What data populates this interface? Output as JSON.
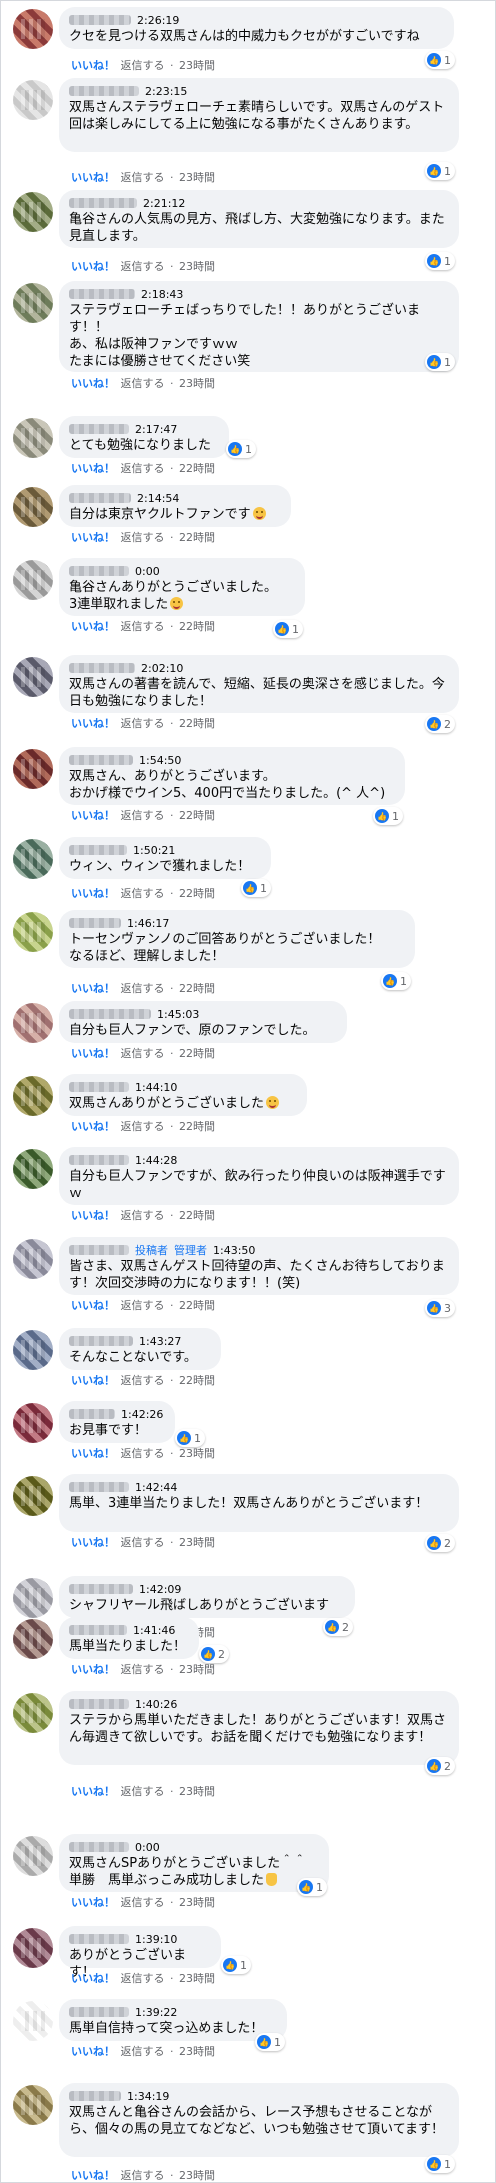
{
  "ui": {
    "like": "いいね！",
    "reply": "返信する",
    "sep": "·",
    "age_22": "22時間",
    "age_23": "23時間",
    "like_color": "#1877f2"
  },
  "comments": [
    {
      "time": "2:26:19",
      "text": "クセを見つける双馬さんは的中威力もクセががすごいですね",
      "react": "1",
      "age": "23時間"
    },
    {
      "time": "2:23:15",
      "text": "双馬さんステラヴェローチェ素晴らしいです。双馬さんのゲスト回は楽しみにしてる上に勉強になる事がたくさんあります。",
      "react": "1",
      "age": "23時間"
    },
    {
      "time": "2:21:12",
      "text": "亀谷さんの人気馬の見方、飛ばし方、大変勉強になります。また見直します。",
      "react": "1",
      "age": "23時間"
    },
    {
      "time": "2:18:43",
      "text": "ステラヴェローチェばっちりでした！！ありがとうございます！！\nあ、私は阪神ファンですｗｗ\nたまには優勝させてください笑",
      "react": "1",
      "age": "23時間"
    },
    {
      "time": "2:17:47",
      "text": "とても勉強になりました",
      "react": "1",
      "age": "22時間"
    },
    {
      "time": "2:14:54",
      "text": "自分は東京ヤクルトファンです",
      "react": "",
      "age": "22時間"
    },
    {
      "time": "0:00",
      "text": "亀谷さんありがとうございました。\n3連単取れました",
      "react": "1",
      "age": "22時間"
    },
    {
      "time": "2:02:10",
      "text": "双馬さんの著書を読んで、短縮、延長の奥深さを感じました。今日も勉強になりました！",
      "react": "2",
      "age": "22時間"
    },
    {
      "time": "1:54:50",
      "text": "双馬さん、ありがとうございます。\nおかげ様でウイン5、400円で当たりました。(^ 人^)",
      "react": "1",
      "age": "22時間"
    },
    {
      "time": "1:50:21",
      "text": "ウィン、ウィンで獲れました！",
      "react": "1",
      "age": "22時間"
    },
    {
      "time": "1:46:17",
      "text": "トーセンヴァンノのご回答ありがとうございました！\nなるほど、理解しました！",
      "react": "1",
      "age": "22時間"
    },
    {
      "time": "1:45:03",
      "text": "自分も巨人ファンで、原のファンでした。",
      "react": "",
      "age": "22時間"
    },
    {
      "time": "1:44:10",
      "text": "双馬さんありがとうございました",
      "react": "",
      "age": "22時間"
    },
    {
      "time": "1:44:28",
      "text": "自分も巨人ファンですが、飲み行ったり仲良いのは阪神選手ですｗ",
      "react": "",
      "age": "22時間"
    },
    {
      "time": "1:43:50",
      "badge1": "投稿者",
      "badge2": "管理者",
      "text": "皆さま、双馬さんゲスト回待望の声、たくさんお待ちしております！次回交渉時の力になります！！(笑)",
      "react": "3",
      "age": "22時間"
    },
    {
      "time": "1:43:27",
      "text": "そんなことないです。",
      "react": "",
      "age": "22時間"
    },
    {
      "time": "1:42:26",
      "text": "お見事です！",
      "react": "1",
      "age": "23時間"
    },
    {
      "time": "1:42:44",
      "text": "馬単、3連単当たりました！双馬さんありがとうございます！",
      "react": "2",
      "age": "23時間"
    },
    {
      "time": "1:42:09",
      "text": "シャフリヤール飛ばしありがとうございます",
      "react": "2",
      "age": "23時間"
    },
    {
      "time": "1:41:46",
      "text": "馬単当たりました！",
      "react": "2",
      "age": "23時間"
    },
    {
      "time": "1:40:26",
      "text": "ステラから馬単いただきました！ありがとうございます！双馬さん毎週きて欲しいです。お話を聞くだけでも勉強になります！",
      "react": "2",
      "age": "23時間"
    },
    {
      "time": "0:00",
      "text": "双馬さんSPありがとうございました＾＾\n単勝　馬単ぶっこみ成功しました",
      "react": "1",
      "age": "23時間"
    },
    {
      "time": "1:39:10",
      "text": "ありがとうございます！",
      "react": "1",
      "age": "23時間"
    },
    {
      "time": "1:39:22",
      "text": "馬単自信持って突っ込めました！",
      "react": "1",
      "age": "23時間"
    },
    {
      "time": "1:34:19",
      "text": "双馬さんと亀谷さんの会話から、レース予想もさせることながら、個々の馬の見立てなどなど、いつも勉強させて頂いてます！",
      "react": "1",
      "age": "23時間"
    }
  ]
}
